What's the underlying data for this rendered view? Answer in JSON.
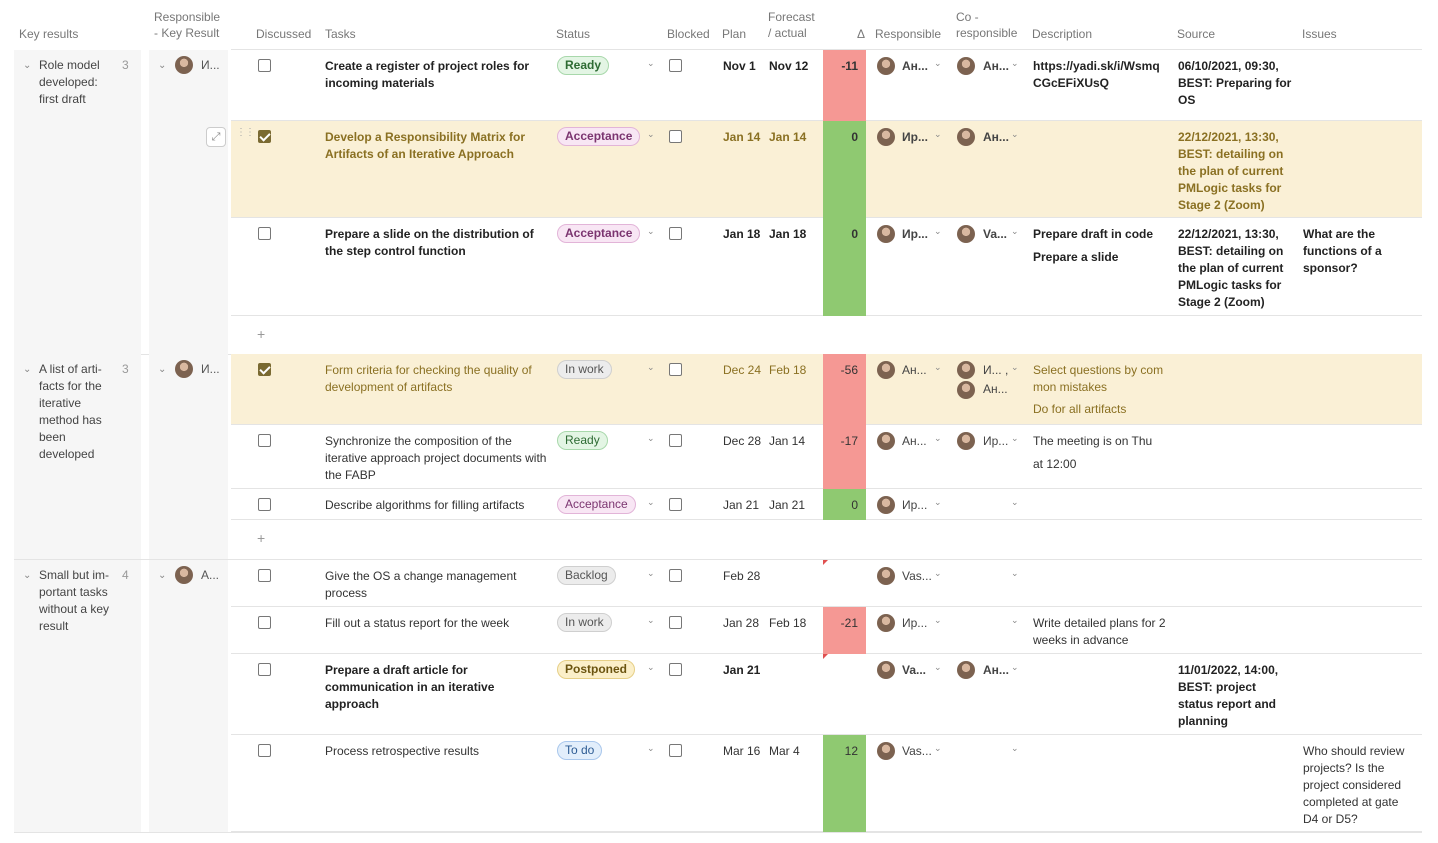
{
  "headers": {
    "key_results": "Key results",
    "responsible_kr": "Responsible\n- Key Result",
    "discussed": "Discussed",
    "tasks": "Tasks",
    "status": "Status",
    "blocked": "Blocked",
    "plan": "Plan",
    "forecast": "Forecast\n/ actual",
    "delta": "Δ",
    "responsible": "Responsible",
    "co_responsible": "Co -\nresponsible",
    "description": "Description",
    "source": "Source",
    "issues": "Issues"
  },
  "groups": [
    {
      "title": "Role model developed: first draft",
      "count": "3",
      "responsible": "И...",
      "add_label": "+",
      "rows": [
        {
          "discussed": false,
          "task": "Create a register of project roles for incoming materials",
          "status": "Ready",
          "plan": "Nov 1",
          "forecast": "Nov 12",
          "delta": "-11",
          "responsible": "Ан...",
          "co_responsible": "Ан...",
          "description": "https://yadi.sk/i/WsmqCGcEFiXUsQ",
          "source": "06/10/2021, 09:30, BEST: Preparing for OS",
          "issues": ""
        },
        {
          "discussed": true,
          "task": "Develop a Responsibility Matrix for Artifacts of an Iterative Approach",
          "status": "Acceptance",
          "plan": "Jan 14",
          "forecast": "Jan 14",
          "delta": "0",
          "responsible": "Ир...",
          "co_responsible": "Ан...",
          "description": "",
          "source": "22/12/2021, 13:30, BEST: detailing on the plan of current PMLogic tasks for Stage 2 (Zoom)",
          "issues": ""
        },
        {
          "discussed": false,
          "task": "Prepare a slide on the distribution of the step control function",
          "status": "Acceptance",
          "plan": "Jan 18",
          "forecast": "Jan 18",
          "delta": "0",
          "responsible": "Ир...",
          "co_responsible": "Va...",
          "description": "Prepare draft in code",
          "description2": "Prepare a slide",
          "source": "22/12/2021, 13:30, BEST: detailing on the plan of current PMLogic tasks for Stage 2 (Zoom)",
          "issues": "What are the functions of a sponsor?"
        }
      ]
    },
    {
      "title": "A list of arti-facts for the iterative method has been developed",
      "count": "3",
      "responsible": "И...",
      "add_label": "+",
      "rows": [
        {
          "discussed": true,
          "task": "Form criteria for checking the quality of development of artifacts",
          "status": "In work",
          "plan": "Dec 24",
          "forecast": "Feb 18",
          "delta": "-56",
          "responsible": "Ан...",
          "co_responsible": "И... ,",
          "co_responsible2": "Ан...",
          "description": "Select questions by common mistakes",
          "description2": "Do for all artifacts",
          "source": "",
          "issues": ""
        },
        {
          "discussed": false,
          "task": "Synchronize the composition of the iterative approach project documents with the FABP",
          "status": "Ready",
          "plan": "Dec 28",
          "forecast": "Jan 14",
          "delta": "-17",
          "responsible": "Ан...",
          "co_responsible": "Ир...",
          "description": "The meeting is on Thu",
          "description2": "at 12:00",
          "source": "",
          "issues": ""
        },
        {
          "discussed": false,
          "task": "Describe algorithms for filling artifacts",
          "status": "Acceptance",
          "plan": "Jan 21",
          "forecast": "Jan 21",
          "delta": "0",
          "responsible": "Ир...",
          "co_responsible": "",
          "description": "",
          "source": "",
          "issues": ""
        }
      ]
    },
    {
      "title": "Small but im-portant tasks without a key result",
      "count": "4",
      "responsible": "А...",
      "rows": [
        {
          "discussed": false,
          "task": "Give the OS a change management process",
          "status": "Backlog",
          "plan": "Feb 28",
          "forecast": "",
          "delta": "",
          "responsible": "Vas...",
          "co_responsible": "",
          "description": "",
          "source": "",
          "issues": ""
        },
        {
          "discussed": false,
          "task": "Fill out a status report for the week",
          "status": "In work",
          "plan": "Jan 28",
          "forecast": "Feb 18",
          "delta": "-21",
          "responsible": "Ир...",
          "co_responsible": "",
          "description": "Write detailed plans for 2 weeks in advance",
          "source": "",
          "issues": ""
        },
        {
          "discussed": false,
          "task": "Prepare a draft article for communication in an iterative approach",
          "status": "Postponed",
          "plan": "Jan 21",
          "forecast": "",
          "delta": "",
          "responsible": "Va...",
          "co_responsible": "Ан...",
          "description": "",
          "source": "11/01/2022, 14:00, BEST: project status report and planning",
          "issues": ""
        },
        {
          "discussed": false,
          "task": "Process retrospective results",
          "status": "To do",
          "plan": "Mar 16",
          "forecast": "Mar 4",
          "delta": "12",
          "responsible": "Vas...",
          "co_responsible": "",
          "description": "",
          "source": "",
          "issues": "Who should review projects? Is the project considered completed at gate D4 or D5?"
        }
      ]
    }
  ],
  "status_colors": {
    "Ready": {
      "bg": "#e3f5e4",
      "border": "#a8d8ab",
      "text": "#2e6b33"
    },
    "Acceptance": {
      "bg": "#f8e6f4",
      "border": "#e2b4d8",
      "text": "#7b3570"
    },
    "In work": {
      "bg": "#ececec",
      "border": "#cfcfcf",
      "text": "#555555"
    },
    "Backlog": {
      "bg": "#ececec",
      "border": "#cfcfcf",
      "text": "#555555"
    },
    "Postponed": {
      "bg": "#fbefc9",
      "border": "#e6cf86",
      "text": "#6b5410"
    },
    "To do": {
      "bg": "#e2eefb",
      "border": "#a9c7ec",
      "text": "#2c5b93"
    }
  },
  "delta_colors": {
    "negative": "#f59894",
    "non_negative": "#8fc971"
  }
}
